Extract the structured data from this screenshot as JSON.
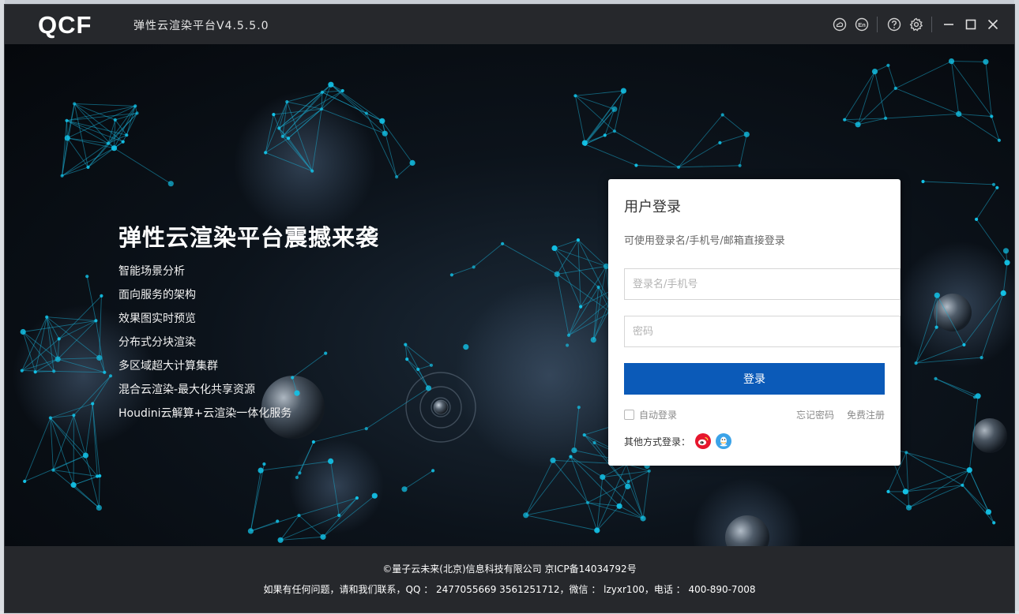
{
  "titlebar": {
    "logo": "QCF",
    "title": "弹性云渲染平台V4.5.5.0",
    "icons": [
      "cloud-icon",
      "language-en-icon",
      "help-icon",
      "settings-gear-icon",
      "minimize-icon",
      "maximize-icon",
      "close-icon"
    ],
    "lang_label": "En"
  },
  "hero": {
    "headline": "弹性云渲染平台震撼来袭",
    "features": [
      "智能场景分析",
      "面向服务的架构",
      "效果图实时预览",
      "分布式分块渲染",
      "多区域超大计算集群",
      "混合云渲染-最大化共享资源",
      "Houdini云解算+云渲染一体化服务"
    ]
  },
  "login": {
    "title": "用户登录",
    "hint": "可使用登录名/手机号/邮箱直接登录",
    "username_placeholder": "登录名/手机号",
    "username_value": "",
    "password_placeholder": "密码",
    "password_value": "",
    "submit_label": "登录",
    "auto_login_label": "自动登录",
    "forgot_label": "忘记密码",
    "register_label": "免费注册",
    "other_label": "其他方式登录：",
    "social": [
      "weibo-icon",
      "qq-icon"
    ]
  },
  "colors": {
    "primary": "#0b5ab8",
    "titlebar": "#26282c",
    "node": "#13c3e8"
  },
  "footer": {
    "line1": "©量子云未来(北京)信息科技有限公司 京ICP备14034792号",
    "line2": "如果有任何问题，请和我们联系，QQ ： 2477055669 3561251712，微信 ： lzyxr100，电话 ： 400-890-7008"
  }
}
